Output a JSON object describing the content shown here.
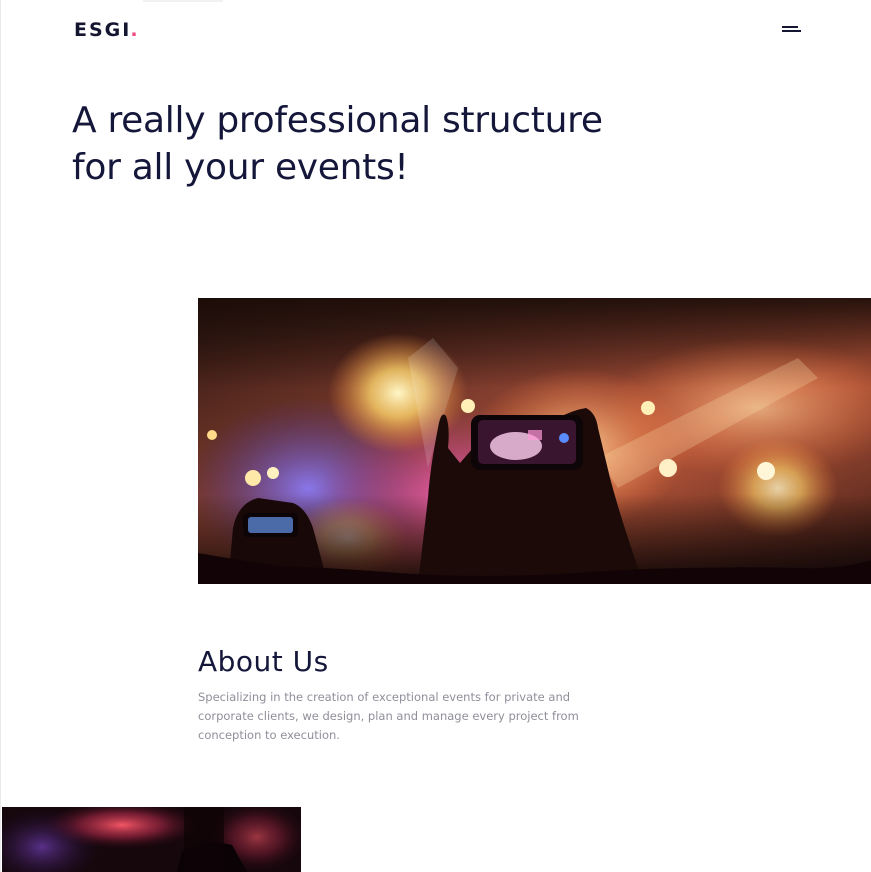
{
  "header": {
    "logo_text": "ESGI",
    "logo_dot": ".",
    "menu_icon": "hamburger-menu-icon"
  },
  "hero": {
    "title": "A really professional structure for all your events!",
    "image_description_icon": "concert-photo"
  },
  "about": {
    "title": "About Us",
    "text": "Specializing in the creation of exceptional events for private and corporate clients, we design, plan and manage every project from conception to execution."
  },
  "colors": {
    "text_dark": "#15173a",
    "accent": "#f04a86",
    "body_text": "#8f8f9a",
    "background": "#ffffff"
  }
}
